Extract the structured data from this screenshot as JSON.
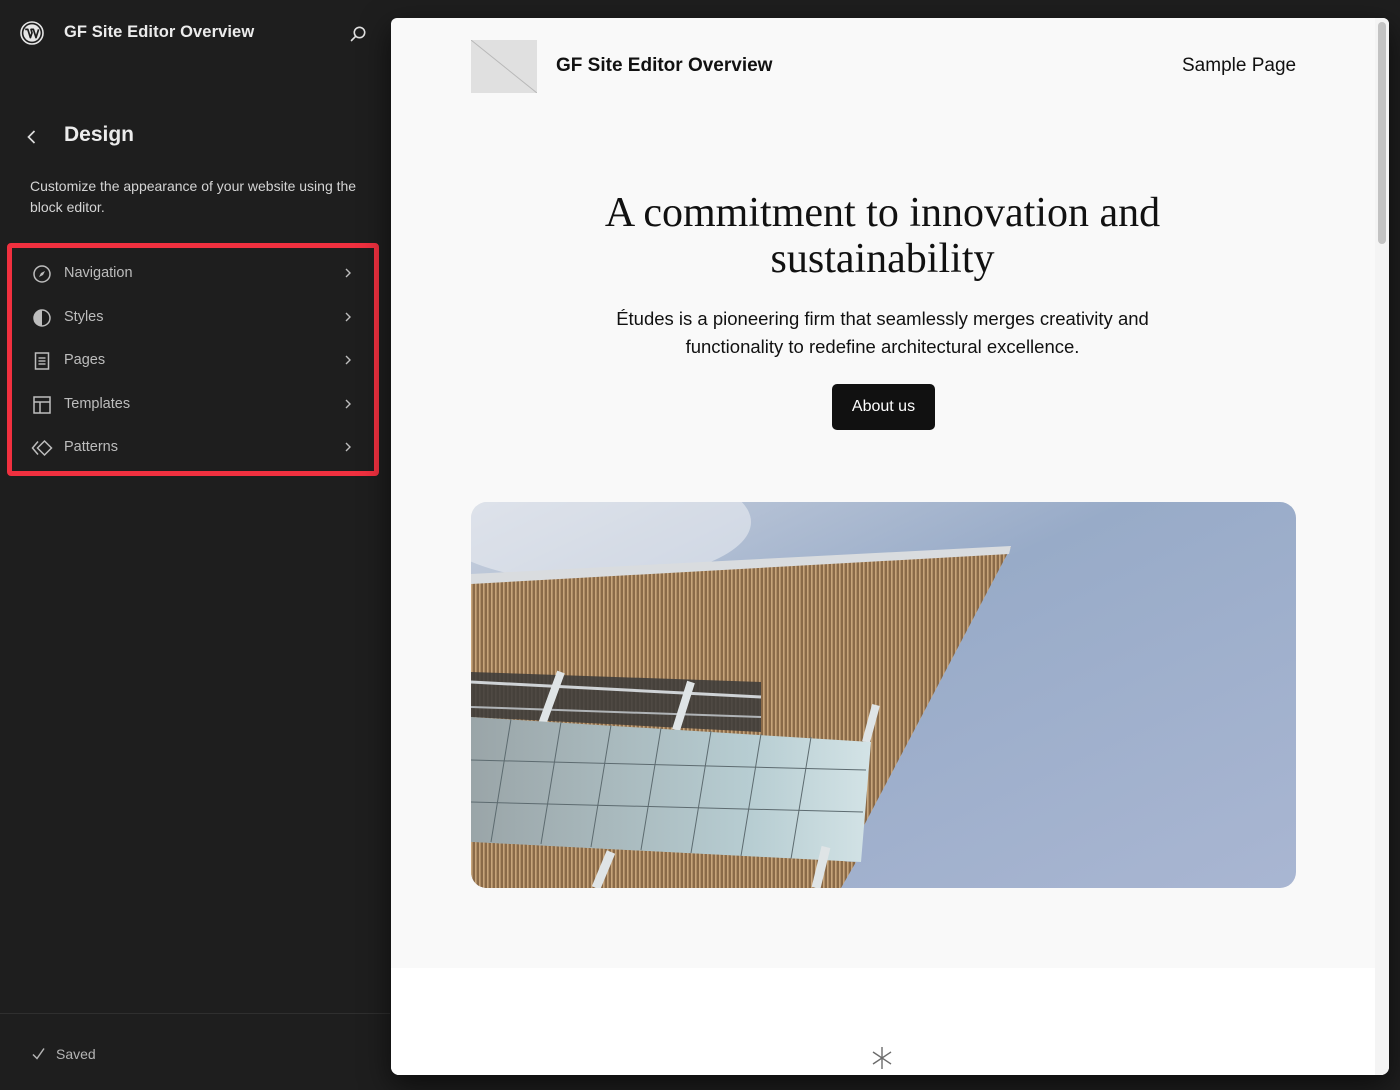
{
  "sidebar": {
    "site_title": "GF Site Editor Overview",
    "icons": {
      "logo": "wordpress-logo-icon",
      "search": "search-icon",
      "back": "chevron-left-icon"
    },
    "section_title": "Design",
    "description": "Customize the appearance of your website using the block editor.",
    "menu": [
      {
        "label": "Navigation",
        "icon": "compass-icon"
      },
      {
        "label": "Styles",
        "icon": "half-circle-contrast-icon"
      },
      {
        "label": "Pages",
        "icon": "page-icon"
      },
      {
        "label": "Templates",
        "icon": "layout-icon"
      },
      {
        "label": "Patterns",
        "icon": "diamond-symbol-icon"
      }
    ],
    "footer": {
      "status_label": "Saved",
      "status_icon": "check-icon"
    }
  },
  "highlight_color": "#f0303f",
  "preview": {
    "site_title": "GF Site Editor Overview",
    "nav_link": "Sample Page",
    "hero_title": "A commitment to innovation and sustainability",
    "hero_description": "Études is a pioneering firm that seamlessly merges creativity and functionality to redefine architectural excellence.",
    "cta_label": "About us",
    "hero_image_alt": "Modern building with wooden slat overhang against blue sky"
  }
}
